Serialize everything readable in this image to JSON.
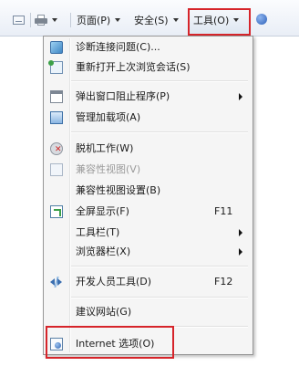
{
  "toolbar": {
    "mail_icon": "read-mail-icon",
    "print_icon": "printer-icon",
    "page_label": "页面(P)",
    "safety_label": "安全(S)",
    "tools_label": "工具(O)",
    "help_icon": "help-icon",
    "highlight_color": "#d6242a"
  },
  "menu": {
    "items": [
      {
        "label": "诊断连接问题(C)...",
        "shortcut": "",
        "icon": "diagnose-icon",
        "has_submenu": false,
        "disabled": false
      },
      {
        "label": "重新打开上次浏览会话(S)",
        "shortcut": "",
        "icon": "reopen-session-icon",
        "has_submenu": false,
        "disabled": false
      },
      {
        "label": "弹出窗口阻止程序(P)",
        "shortcut": "",
        "icon": "popup-blocker-icon",
        "has_submenu": true,
        "disabled": false
      },
      {
        "label": "管理加载项(A)",
        "shortcut": "",
        "icon": "manage-addons-icon",
        "has_submenu": false,
        "disabled": false
      },
      {
        "label": "脱机工作(W)",
        "shortcut": "",
        "icon": "work-offline-icon",
        "has_submenu": false,
        "disabled": false
      },
      {
        "label": "兼容性视图(V)",
        "shortcut": "",
        "icon": "compat-view-icon",
        "has_submenu": false,
        "disabled": true
      },
      {
        "label": "兼容性视图设置(B)",
        "shortcut": "",
        "icon": "",
        "has_submenu": false,
        "disabled": false
      },
      {
        "label": "全屏显示(F)",
        "shortcut": "F11",
        "icon": "fullscreen-icon",
        "has_submenu": false,
        "disabled": false
      },
      {
        "label": "工具栏(T)",
        "shortcut": "",
        "icon": "",
        "has_submenu": true,
        "disabled": false
      },
      {
        "label": "浏览器栏(X)",
        "shortcut": "",
        "icon": "",
        "has_submenu": true,
        "disabled": false
      },
      {
        "label": "开发人员工具(D)",
        "shortcut": "F12",
        "icon": "developer-tools-icon",
        "has_submenu": false,
        "disabled": false
      },
      {
        "label": "建议网站(G)",
        "shortcut": "",
        "icon": "",
        "has_submenu": false,
        "disabled": false
      },
      {
        "label": "Internet 选项(O)",
        "shortcut": "",
        "icon": "internet-options-icon",
        "has_submenu": false,
        "disabled": false
      }
    ]
  }
}
